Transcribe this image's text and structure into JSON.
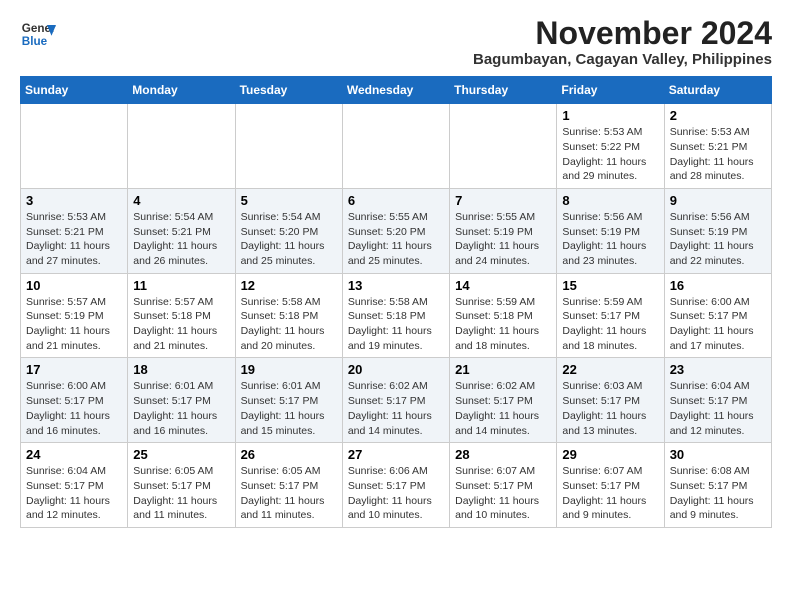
{
  "header": {
    "logo_line1": "General",
    "logo_line2": "Blue",
    "month": "November 2024",
    "location": "Bagumbayan, Cagayan Valley, Philippines"
  },
  "weekdays": [
    "Sunday",
    "Monday",
    "Tuesday",
    "Wednesday",
    "Thursday",
    "Friday",
    "Saturday"
  ],
  "weeks": [
    [
      {
        "day": "",
        "info": ""
      },
      {
        "day": "",
        "info": ""
      },
      {
        "day": "",
        "info": ""
      },
      {
        "day": "",
        "info": ""
      },
      {
        "day": "",
        "info": ""
      },
      {
        "day": "1",
        "info": "Sunrise: 5:53 AM\nSunset: 5:22 PM\nDaylight: 11 hours and 29 minutes."
      },
      {
        "day": "2",
        "info": "Sunrise: 5:53 AM\nSunset: 5:21 PM\nDaylight: 11 hours and 28 minutes."
      }
    ],
    [
      {
        "day": "3",
        "info": "Sunrise: 5:53 AM\nSunset: 5:21 PM\nDaylight: 11 hours and 27 minutes."
      },
      {
        "day": "4",
        "info": "Sunrise: 5:54 AM\nSunset: 5:21 PM\nDaylight: 11 hours and 26 minutes."
      },
      {
        "day": "5",
        "info": "Sunrise: 5:54 AM\nSunset: 5:20 PM\nDaylight: 11 hours and 25 minutes."
      },
      {
        "day": "6",
        "info": "Sunrise: 5:55 AM\nSunset: 5:20 PM\nDaylight: 11 hours and 25 minutes."
      },
      {
        "day": "7",
        "info": "Sunrise: 5:55 AM\nSunset: 5:19 PM\nDaylight: 11 hours and 24 minutes."
      },
      {
        "day": "8",
        "info": "Sunrise: 5:56 AM\nSunset: 5:19 PM\nDaylight: 11 hours and 23 minutes."
      },
      {
        "day": "9",
        "info": "Sunrise: 5:56 AM\nSunset: 5:19 PM\nDaylight: 11 hours and 22 minutes."
      }
    ],
    [
      {
        "day": "10",
        "info": "Sunrise: 5:57 AM\nSunset: 5:19 PM\nDaylight: 11 hours and 21 minutes."
      },
      {
        "day": "11",
        "info": "Sunrise: 5:57 AM\nSunset: 5:18 PM\nDaylight: 11 hours and 21 minutes."
      },
      {
        "day": "12",
        "info": "Sunrise: 5:58 AM\nSunset: 5:18 PM\nDaylight: 11 hours and 20 minutes."
      },
      {
        "day": "13",
        "info": "Sunrise: 5:58 AM\nSunset: 5:18 PM\nDaylight: 11 hours and 19 minutes."
      },
      {
        "day": "14",
        "info": "Sunrise: 5:59 AM\nSunset: 5:18 PM\nDaylight: 11 hours and 18 minutes."
      },
      {
        "day": "15",
        "info": "Sunrise: 5:59 AM\nSunset: 5:17 PM\nDaylight: 11 hours and 18 minutes."
      },
      {
        "day": "16",
        "info": "Sunrise: 6:00 AM\nSunset: 5:17 PM\nDaylight: 11 hours and 17 minutes."
      }
    ],
    [
      {
        "day": "17",
        "info": "Sunrise: 6:00 AM\nSunset: 5:17 PM\nDaylight: 11 hours and 16 minutes."
      },
      {
        "day": "18",
        "info": "Sunrise: 6:01 AM\nSunset: 5:17 PM\nDaylight: 11 hours and 16 minutes."
      },
      {
        "day": "19",
        "info": "Sunrise: 6:01 AM\nSunset: 5:17 PM\nDaylight: 11 hours and 15 minutes."
      },
      {
        "day": "20",
        "info": "Sunrise: 6:02 AM\nSunset: 5:17 PM\nDaylight: 11 hours and 14 minutes."
      },
      {
        "day": "21",
        "info": "Sunrise: 6:02 AM\nSunset: 5:17 PM\nDaylight: 11 hours and 14 minutes."
      },
      {
        "day": "22",
        "info": "Sunrise: 6:03 AM\nSunset: 5:17 PM\nDaylight: 11 hours and 13 minutes."
      },
      {
        "day": "23",
        "info": "Sunrise: 6:04 AM\nSunset: 5:17 PM\nDaylight: 11 hours and 12 minutes."
      }
    ],
    [
      {
        "day": "24",
        "info": "Sunrise: 6:04 AM\nSunset: 5:17 PM\nDaylight: 11 hours and 12 minutes."
      },
      {
        "day": "25",
        "info": "Sunrise: 6:05 AM\nSunset: 5:17 PM\nDaylight: 11 hours and 11 minutes."
      },
      {
        "day": "26",
        "info": "Sunrise: 6:05 AM\nSunset: 5:17 PM\nDaylight: 11 hours and 11 minutes."
      },
      {
        "day": "27",
        "info": "Sunrise: 6:06 AM\nSunset: 5:17 PM\nDaylight: 11 hours and 10 minutes."
      },
      {
        "day": "28",
        "info": "Sunrise: 6:07 AM\nSunset: 5:17 PM\nDaylight: 11 hours and 10 minutes."
      },
      {
        "day": "29",
        "info": "Sunrise: 6:07 AM\nSunset: 5:17 PM\nDaylight: 11 hours and 9 minutes."
      },
      {
        "day": "30",
        "info": "Sunrise: 6:08 AM\nSunset: 5:17 PM\nDaylight: 11 hours and 9 minutes."
      }
    ]
  ]
}
